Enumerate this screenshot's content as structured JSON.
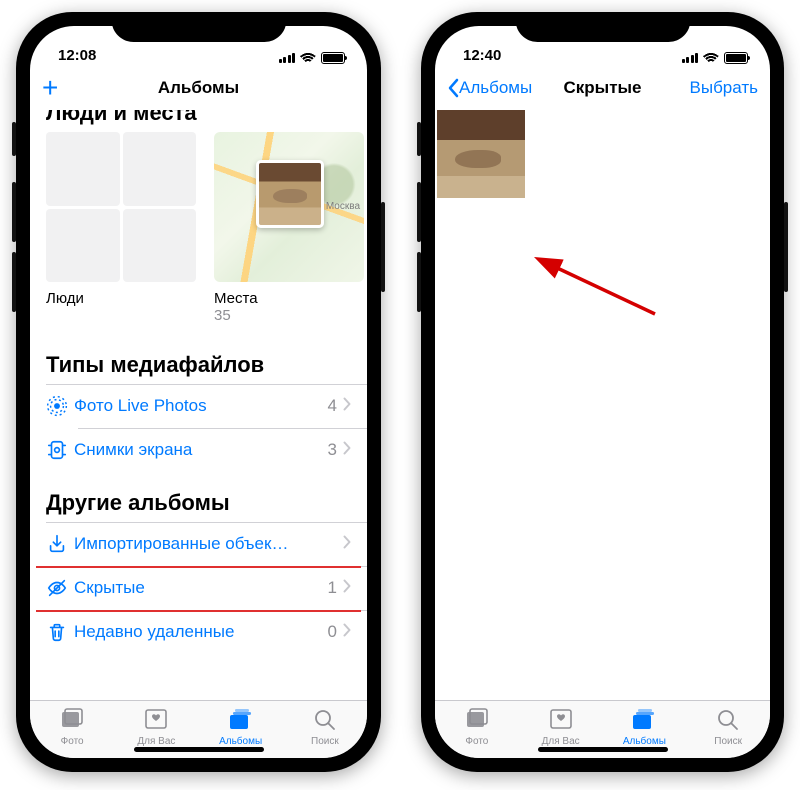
{
  "left": {
    "status_time": "12:08",
    "nav_title": "Альбомы",
    "people_places_header": "Люди и места",
    "collections": {
      "people": {
        "label": "Люди"
      },
      "places": {
        "label": "Места",
        "count": "35",
        "map_city": "Москва"
      }
    },
    "media_types_header": "Типы медиафайлов",
    "media_rows": [
      {
        "icon": "live",
        "label": "Фото Live Photos",
        "count": "4"
      },
      {
        "icon": "screenshot",
        "label": "Снимки экрана",
        "count": "3"
      }
    ],
    "other_albums_header": "Другие альбомы",
    "other_rows": [
      {
        "icon": "import",
        "label": "Импортированные объек…",
        "count": ""
      },
      {
        "icon": "hidden",
        "label": "Скрытые",
        "count": "1"
      },
      {
        "icon": "trash",
        "label": "Недавно удаленные",
        "count": "0"
      }
    ]
  },
  "right": {
    "status_time": "12:40",
    "back_label": "Альбомы",
    "nav_title": "Скрытые",
    "select_label": "Выбрать"
  },
  "tabs": [
    {
      "key": "photos",
      "label": "Фото"
    },
    {
      "key": "foryou",
      "label": "Для Вас"
    },
    {
      "key": "albums",
      "label": "Альбомы"
    },
    {
      "key": "search",
      "label": "Поиск"
    }
  ],
  "active_tab": "albums"
}
